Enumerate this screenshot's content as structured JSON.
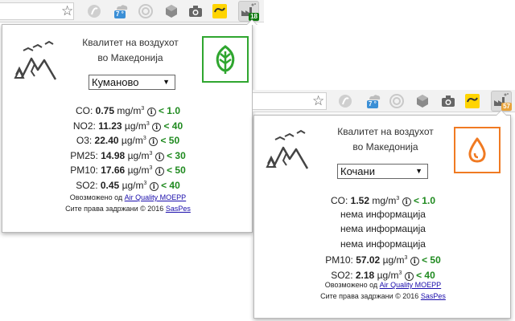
{
  "colors": {
    "good": "#1f8a1f",
    "green_box": "#2fa62f",
    "orange_box": "#f07a22",
    "ext_badge_1": "#0f7a0f",
    "ext_badge_2": "#e8a33b"
  },
  "toolbar1": {
    "weather_temp": "7 °",
    "ext_badge": "18"
  },
  "toolbar2": {
    "weather_temp": "7 °",
    "ext_badge": "57"
  },
  "popup1": {
    "title_line1": "Квалитет на воздухот",
    "title_line2": "во Македонија",
    "status_icon": "leaf-icon",
    "city": "Куманово",
    "rows": [
      {
        "label": "CO: ",
        "value": "0.75",
        "unit": "mg/m",
        "threshold": "< 1.0"
      },
      {
        "label": "NO2: ",
        "value": "11.23",
        "unit": "µg/m",
        "threshold": "< 40"
      },
      {
        "label": "O3: ",
        "value": "22.40",
        "unit": "µg/m",
        "threshold": "< 50"
      },
      {
        "label": "PM25: ",
        "value": "14.98",
        "unit": "µg/m",
        "threshold": "< 30"
      },
      {
        "label": "PM10: ",
        "value": "17.66",
        "unit": "µg/m",
        "threshold": "< 50"
      },
      {
        "label": "SO2: ",
        "value": "0.45",
        "unit": "µg/m",
        "threshold": "< 40"
      }
    ],
    "footer_prefix": "Овозможено од ",
    "footer_link": "Air Quality MOEPP",
    "copyright_prefix": "Сите права задржани © 2016 ",
    "copyright_link": "SasPes"
  },
  "popup2": {
    "title_line1": "Квалитет на воздухот",
    "title_line2": "во Македонија",
    "status_icon": "drop-icon",
    "city": "Кочани",
    "co_row": {
      "label": "CO: ",
      "value": "1.52",
      "unit": "mg/m",
      "threshold": "< 1.0"
    },
    "no_info": [
      "нема информација",
      "нема информација",
      "нема информација"
    ],
    "pm10_row": {
      "label": "PM10: ",
      "value": "57.02",
      "unit": "µg/m",
      "threshold": "< 50"
    },
    "so2_row": {
      "label": "SO2: ",
      "value": "2.18",
      "unit": "µg/m",
      "threshold": "< 40"
    },
    "footer_prefix": "Овозможено од ",
    "footer_link": "Air Quality MOEPP",
    "copyright_prefix": "Сите права задржани © 2016 ",
    "copyright_link": "SasPes"
  },
  "cube_sup": "3",
  "info_glyph": "i"
}
